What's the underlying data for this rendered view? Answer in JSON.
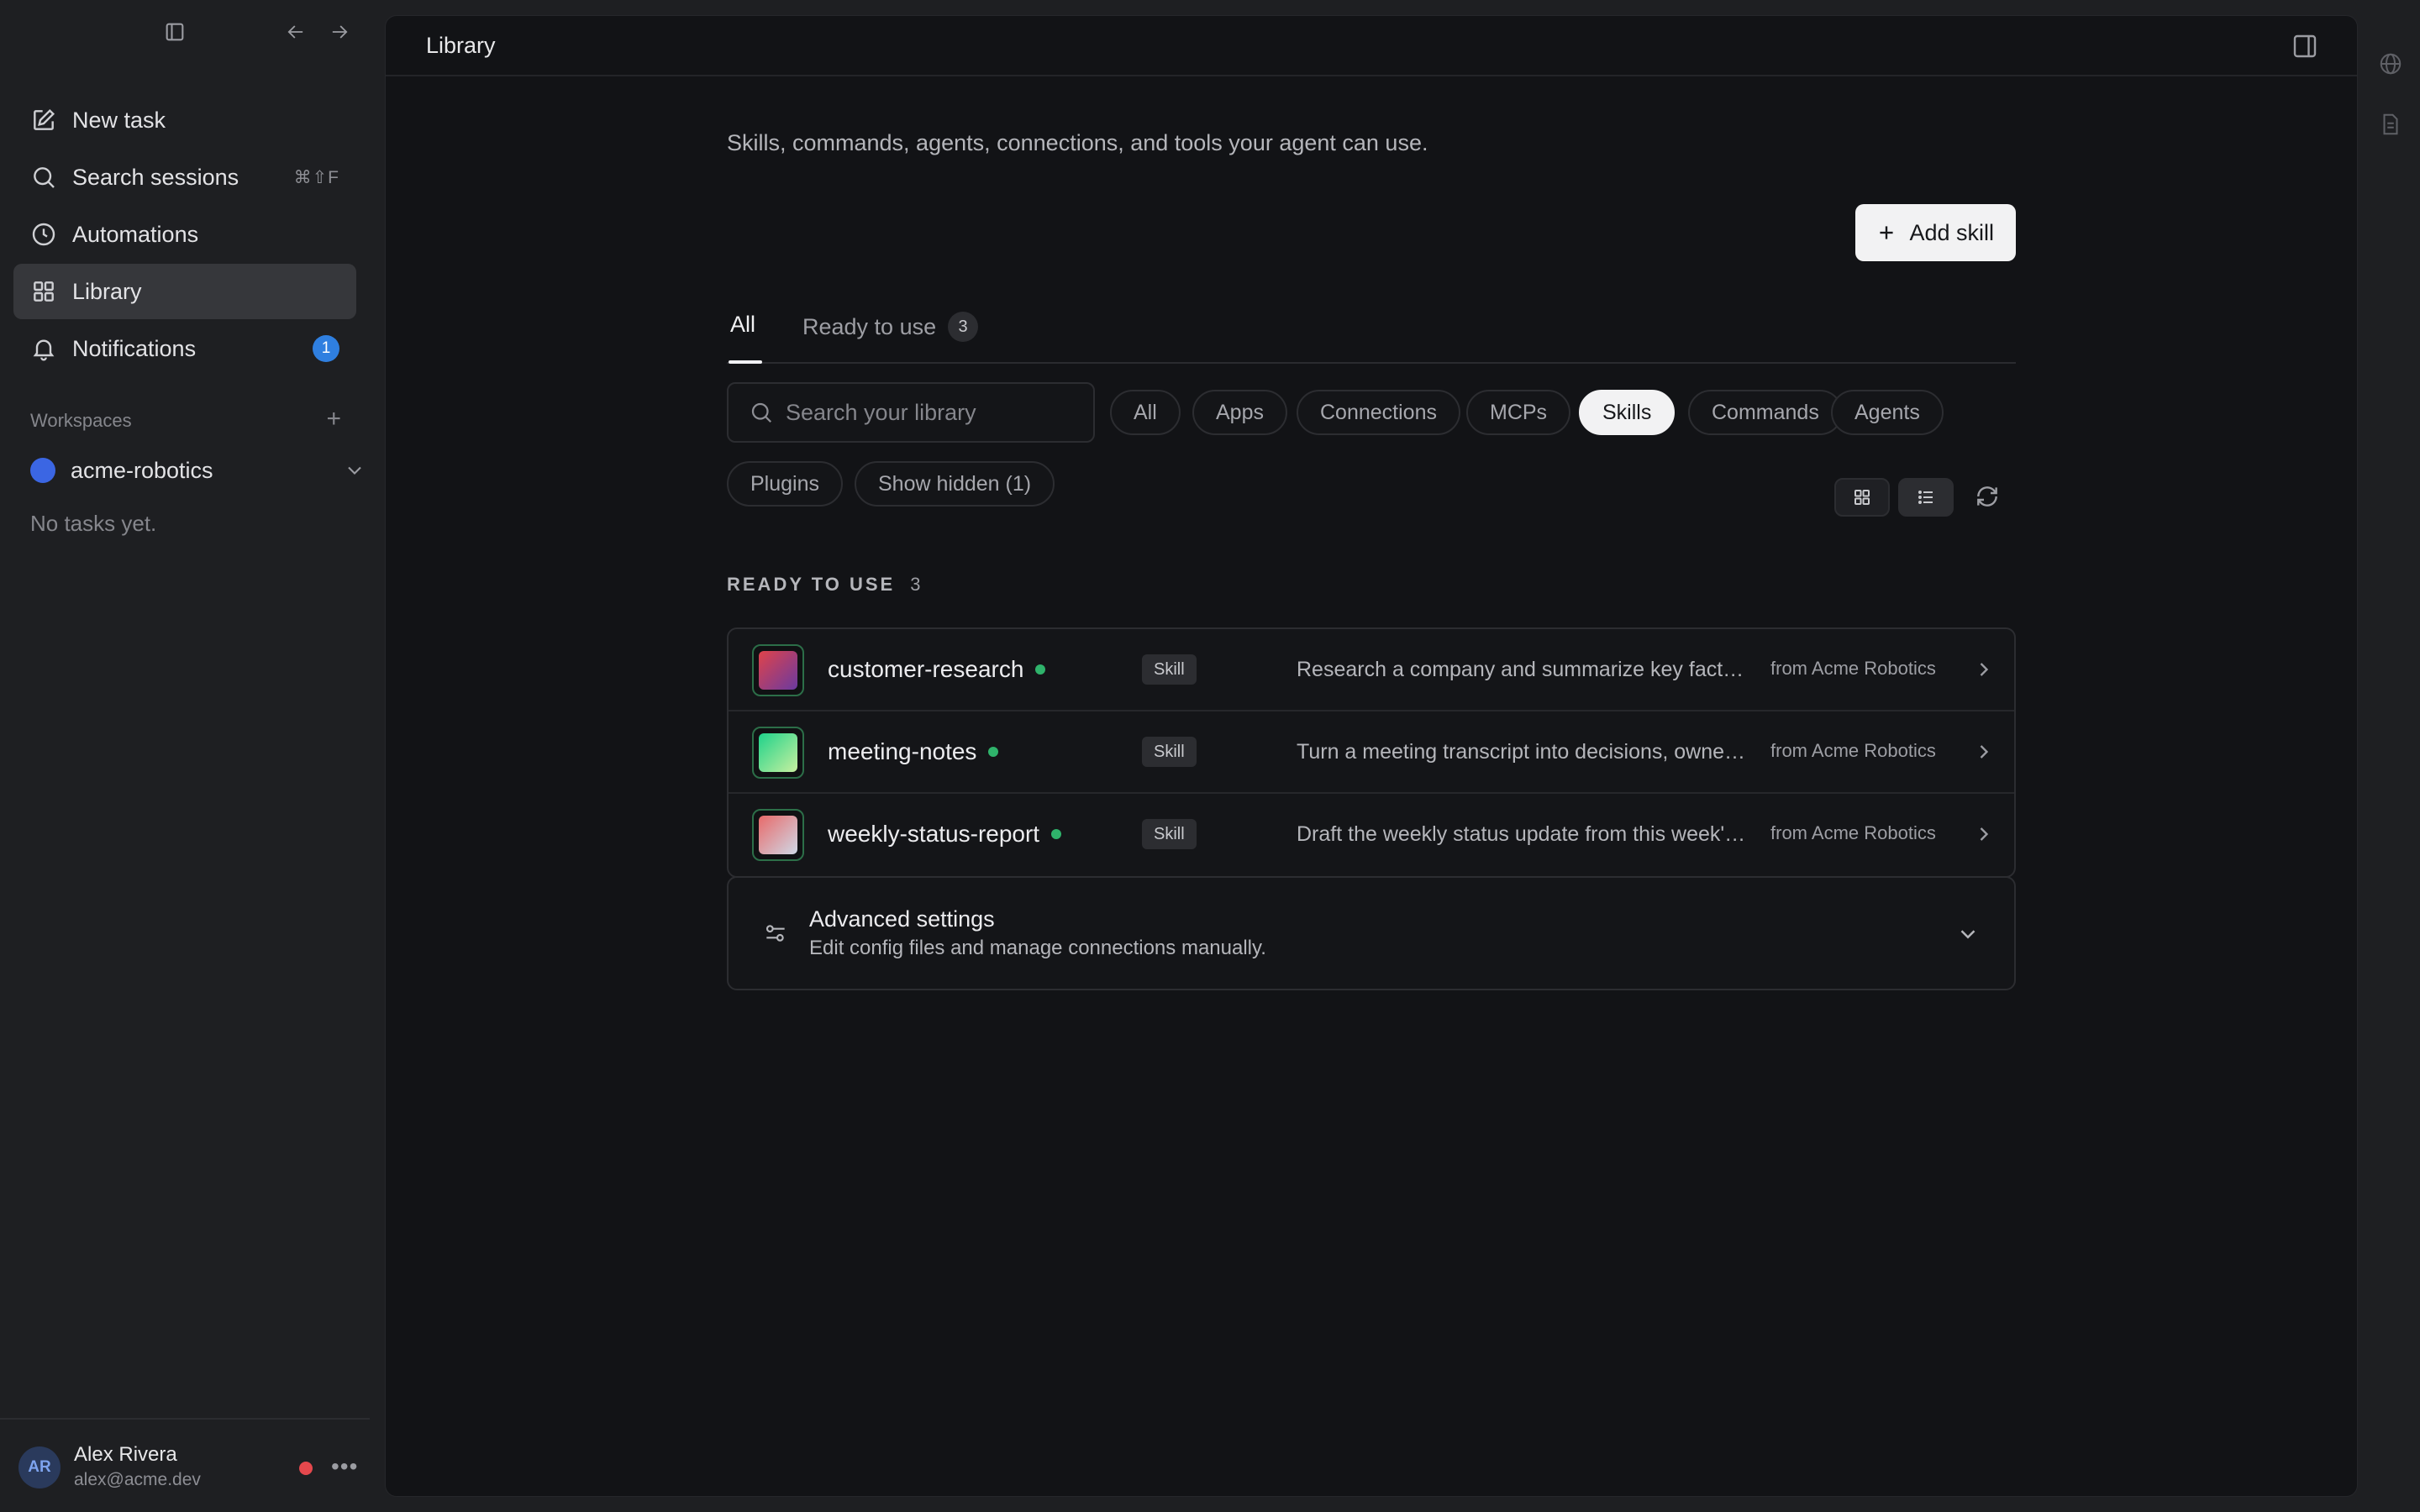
{
  "sidebar": {
    "nav": [
      {
        "label": "New task",
        "icon": "edit-icon"
      },
      {
        "label": "Search sessions",
        "icon": "search-icon",
        "shortcut": "⌘⇧F"
      },
      {
        "label": "Automations",
        "icon": "clock-icon"
      },
      {
        "label": "Library",
        "icon": "grid-icon",
        "active": true
      },
      {
        "label": "Notifications",
        "icon": "bell-icon",
        "badge": "1"
      }
    ],
    "workspaces_label": "Workspaces",
    "workspace": {
      "name": "acme-robotics",
      "color": "#3b66e3"
    },
    "empty_text": "No tasks yet.",
    "user": {
      "initials": "AR",
      "name": "Alex Rivera",
      "email": "alex@acme.dev",
      "status_color": "#e5484d"
    }
  },
  "main": {
    "title": "Library",
    "subtitle": "Skills, commands, agents, connections, and tools your agent can use.",
    "add_button": "Add skill",
    "tabs": [
      {
        "label": "All",
        "active": true
      },
      {
        "label": "Ready to use",
        "count": "3"
      }
    ],
    "search": {
      "placeholder": "Search your library",
      "value": ""
    },
    "filters": [
      {
        "label": "All"
      },
      {
        "label": "Apps"
      },
      {
        "label": "Connections"
      },
      {
        "label": "MCPs"
      },
      {
        "label": "Skills",
        "selected": true
      },
      {
        "label": "Commands"
      },
      {
        "label": "Agents"
      },
      {
        "label": "Plugins"
      },
      {
        "label": "Show hidden (1)"
      }
    ],
    "view_mode": "list",
    "section": {
      "label": "READY TO USE",
      "count": "3"
    },
    "items": [
      {
        "name": "customer-research",
        "type": "Skill",
        "description": "Research a company and summarize key facts for a sales call.",
        "source": "from Acme Robotics",
        "colors": [
          "#e0434a",
          "#6a3aa0"
        ],
        "status": "active"
      },
      {
        "name": "meeting-notes",
        "type": "Skill",
        "description": "Turn a meeting transcript into decisions, owners and next steps.",
        "source": "from Acme Robotics",
        "colors": [
          "#1fd28a",
          "#c8f0a0"
        ],
        "status": "active"
      },
      {
        "name": "weekly-status-report",
        "type": "Skill",
        "description": "Draft the weekly status update from this week's activity.",
        "source": "from Acme Robotics",
        "colors": [
          "#e86a6a",
          "#cfd8e6"
        ],
        "status": "active"
      }
    ],
    "advanced": {
      "title": "Advanced settings",
      "subtitle": "Edit config files and manage connections manually."
    }
  },
  "colors": {
    "accent_badge": "#2f7fe0",
    "live_dot": "#2fb36b",
    "selected_chip": "#f2f2f3"
  }
}
